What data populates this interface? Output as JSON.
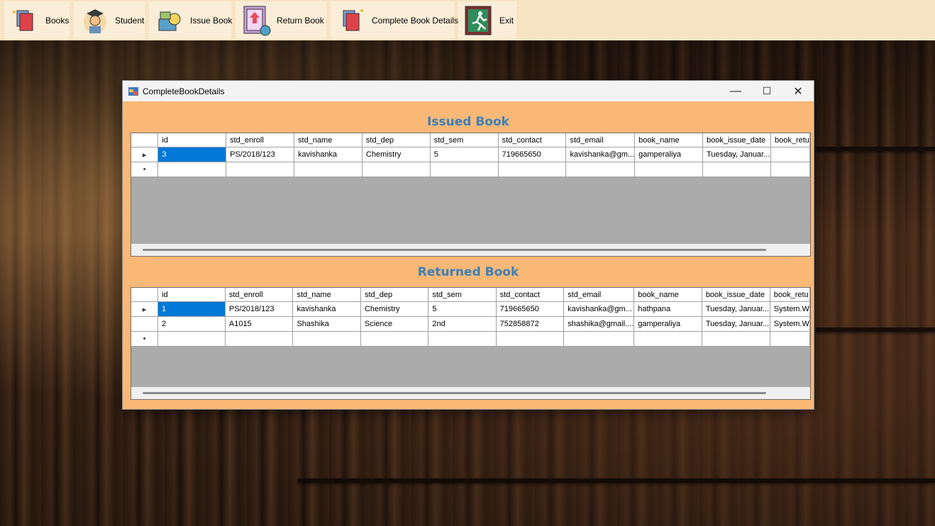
{
  "menu": {
    "items": [
      {
        "label": "Books",
        "icon": "books-icon"
      },
      {
        "label": "Student",
        "icon": "student-icon"
      },
      {
        "label": "Issue Book",
        "icon": "issue-book-icon"
      },
      {
        "label": "Return Book",
        "icon": "return-book-icon"
      },
      {
        "label": "Complete Book Details",
        "icon": "complete-book-details-icon"
      },
      {
        "label": "Exit",
        "icon": "exit-icon"
      }
    ]
  },
  "window": {
    "title": "CompleteBookDetails",
    "minimize": "—",
    "maximize": "☐",
    "close": "✕"
  },
  "issued": {
    "title": "Issued Book",
    "columns": [
      "id",
      "std_enroll",
      "std_name",
      "std_dep",
      "std_sem",
      "std_contact",
      "std_email",
      "book_name",
      "book_issue_date",
      "book_retu"
    ],
    "rows": [
      {
        "marker": "▸",
        "cells": [
          "3",
          "PS/2018/123",
          "kavishanka",
          "Chemistry",
          "5",
          "719665650",
          "kavishanka@gm...",
          "gamperaliya",
          "Tuesday, Januar...",
          ""
        ]
      }
    ],
    "new_row_marker": "•"
  },
  "returned": {
    "title": "Returned Book",
    "columns": [
      "id",
      "std_enroll",
      "std_name",
      "std_dep",
      "std_sem",
      "std_contact",
      "std_email",
      "book_name",
      "book_issue_date",
      "book_retu"
    ],
    "rows": [
      {
        "marker": "▸",
        "cells": [
          "1",
          "PS/2018/123",
          "kavishanka",
          "Chemistry",
          "5",
          "719665650",
          "kavishanka@gm...",
          "hathpana",
          "Tuesday, Januar...",
          "System.W"
        ]
      },
      {
        "marker": "",
        "cells": [
          "2",
          "A1015",
          "Shashika",
          "Science",
          "2nd",
          "752858872",
          "shashika@gmail....",
          "gamperaliya",
          "Tuesday, Januar...",
          "System.W"
        ]
      }
    ],
    "new_row_marker": "•"
  },
  "colors": {
    "menubar": "#f7e4c2",
    "window_body": "#f9b876",
    "section_title": "#3c7fb8",
    "selection": "#0078d7"
  }
}
